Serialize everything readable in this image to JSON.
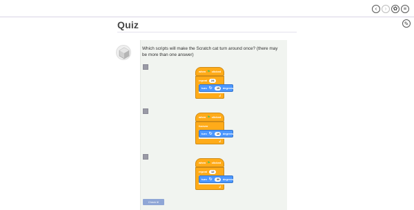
{
  "nav": {
    "prev_icon": "‹",
    "next_icon": "›",
    "settings_icon": "✿",
    "menu_icon": "≡",
    "edit_icon": "✎"
  },
  "page_title": "Quiz",
  "question": "Which scripts will make the Scratch cat turn around once? (there may be more than one answer)",
  "scripts": [
    {
      "hat_label": "when",
      "hat_suffix": "clicked",
      "loop_label": "repeat",
      "loop_count": "24",
      "turn_label": "turn",
      "turn_value": "15",
      "turn_unit": "degrees"
    },
    {
      "hat_label": "when",
      "hat_suffix": "clicked",
      "loop_label": "forever",
      "loop_count": "",
      "turn_label": "turn",
      "turn_value": "10",
      "turn_unit": "degrees"
    },
    {
      "hat_label": "when",
      "hat_suffix": "clicked",
      "loop_label": "repeat",
      "loop_count": "12",
      "turn_label": "turn",
      "turn_value": "30",
      "turn_unit": "degrees"
    }
  ],
  "check_button_label": "Check it!",
  "colors": {
    "events": "#ffab19",
    "motion": "#4c97ff",
    "card": "#f1f4f0",
    "check_button": "#8fa6d6"
  }
}
